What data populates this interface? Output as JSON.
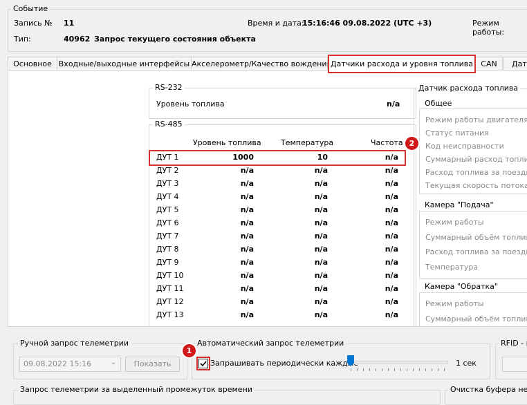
{
  "event": {
    "group_title": "Событие",
    "record_label": "Запись №",
    "record_value": "11",
    "datetime_label": "Время и дата:",
    "datetime_value": "15:16:46 09.08.2022 (UTC +3)",
    "mode_label": "Режим работы:",
    "type_label": "Тип:",
    "type_value": "40962",
    "type_desc": "Запрос текущего состояния объекта"
  },
  "tabs": [
    "Основное",
    "Входные/выходные интерфейсы",
    "Акселерометр/Качество вождения",
    "Датчики расхода и уровня топлива",
    "CAN",
    "Дат"
  ],
  "rs232": {
    "title": "RS-232",
    "fuel_label": "Уровень топлива",
    "fuel_value": "n/a"
  },
  "rs485": {
    "title": "RS-485",
    "headers": [
      "Уровень топлива",
      "Температура",
      "Частота"
    ],
    "rows": [
      {
        "name": "ДУТ 1",
        "level": "1000",
        "temp": "10",
        "freq": "n/a"
      },
      {
        "name": "ДУТ 2",
        "level": "n/a",
        "temp": "n/a",
        "freq": "n/a"
      },
      {
        "name": "ДУТ 3",
        "level": "n/a",
        "temp": "n/a",
        "freq": "n/a"
      },
      {
        "name": "ДУТ 4",
        "level": "n/a",
        "temp": "n/a",
        "freq": "n/a"
      },
      {
        "name": "ДУТ 5",
        "level": "n/a",
        "temp": "n/a",
        "freq": "n/a"
      },
      {
        "name": "ДУТ 6",
        "level": "n/a",
        "temp": "n/a",
        "freq": "n/a"
      },
      {
        "name": "ДУТ 7",
        "level": "n/a",
        "temp": "n/a",
        "freq": "n/a"
      },
      {
        "name": "ДУТ 8",
        "level": "n/a",
        "temp": "n/a",
        "freq": "n/a"
      },
      {
        "name": "ДУТ 9",
        "level": "n/a",
        "temp": "n/a",
        "freq": "n/a"
      },
      {
        "name": "ДУТ 10",
        "level": "n/a",
        "temp": "n/a",
        "freq": "n/a"
      },
      {
        "name": "ДУТ 11",
        "level": "n/a",
        "temp": "n/a",
        "freq": "n/a"
      },
      {
        "name": "ДУТ 12",
        "level": "n/a",
        "temp": "n/a",
        "freq": "n/a"
      },
      {
        "name": "ДУТ 13",
        "level": "n/a",
        "temp": "n/a",
        "freq": "n/a"
      }
    ]
  },
  "flow_sensor": {
    "title": "Датчик расхода топлива",
    "general": {
      "title": "Общее",
      "items": [
        "Режим работы двигателя по",
        "Статус питания",
        "Код неисправности",
        "Суммарный расход топлива",
        "Расход топлива за поездку",
        "Текущая скорость потока"
      ]
    },
    "supply": {
      "title": "Камера \"Подача\"",
      "items": [
        "Режим работы",
        "Суммарный объём топлива",
        "Расход топлива за поездку",
        "Температура"
      ]
    },
    "return": {
      "title": "Камера \"Обратка\"",
      "items": [
        "Режим работы",
        "Суммарный объём топлива"
      ]
    }
  },
  "manual": {
    "title": "Ручной запрос телеметрии",
    "date_value": "09.08.2022 15:16",
    "show_button": "Показать"
  },
  "auto": {
    "title": "Автоматический запрос телеметрии",
    "checkbox_label": "Запрашивать периодически каждые",
    "checked": true,
    "interval_label": "1 сек",
    "slider_fraction": 0.0
  },
  "rfid": {
    "title": "RFID - м"
  },
  "period": {
    "title": "Запрос телеметрии за выделенный промежуток времени"
  },
  "clear": {
    "title": "Очистка буфера непе"
  },
  "badges": [
    "1",
    "2"
  ]
}
